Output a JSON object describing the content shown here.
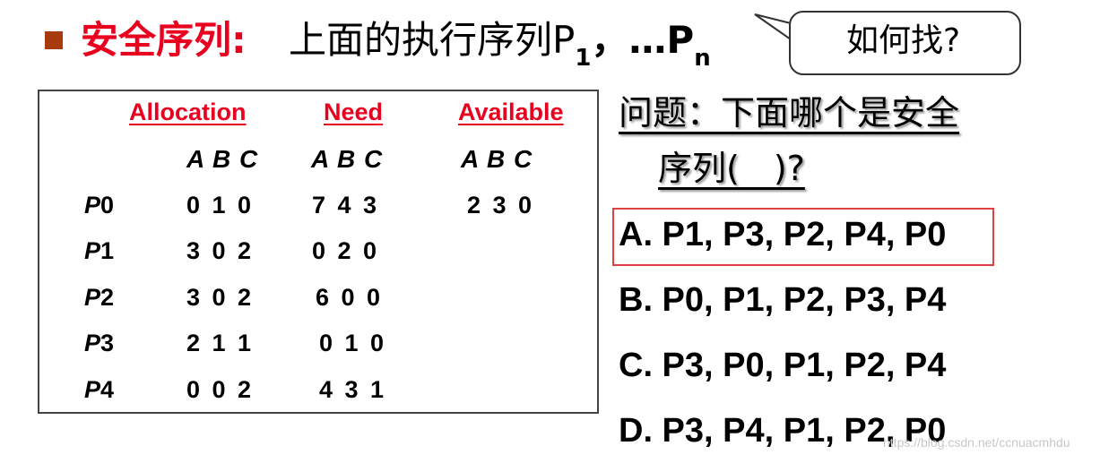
{
  "title": {
    "red": "安全序列:",
    "black_prefix": "上面的执行序列P",
    "sub1": "1",
    "sep": "，…P",
    "subn": "n"
  },
  "callout": "如何找?",
  "table": {
    "headers": [
      "Allocation",
      "Need",
      "Available"
    ],
    "abc": "A B C",
    "rows": [
      {
        "p": "P",
        "n": "0",
        "alloc": "0 1 0",
        "need": "7 4 3",
        "avail": "2 3 0"
      },
      {
        "p": "P",
        "n": "1",
        "alloc": "3 0 2",
        "need": "0 2 0",
        "avail": ""
      },
      {
        "p": "P",
        "n": "2",
        "alloc": "3 0 2",
        "need": "6 0 0",
        "avail": ""
      },
      {
        "p": "P",
        "n": "3",
        "alloc": "2 1 1",
        "need": "0 1 0",
        "avail": ""
      },
      {
        "p": "P",
        "n": "4",
        "alloc": "0 0 2",
        "need": "4 3 1",
        "avail": ""
      }
    ]
  },
  "question": {
    "line1": "问题：下面哪个是安全",
    "line2": "序列(　)?"
  },
  "options": [
    "A. P1, P3, P2, P4, P0",
    "B. P0, P1, P2, P3, P4",
    "C. P3, P0, P1, P2, P4",
    "D. P3, P4, P1, P2, P0"
  ],
  "watermark": "https://blog.csdn.net/ccnuacmhdu"
}
